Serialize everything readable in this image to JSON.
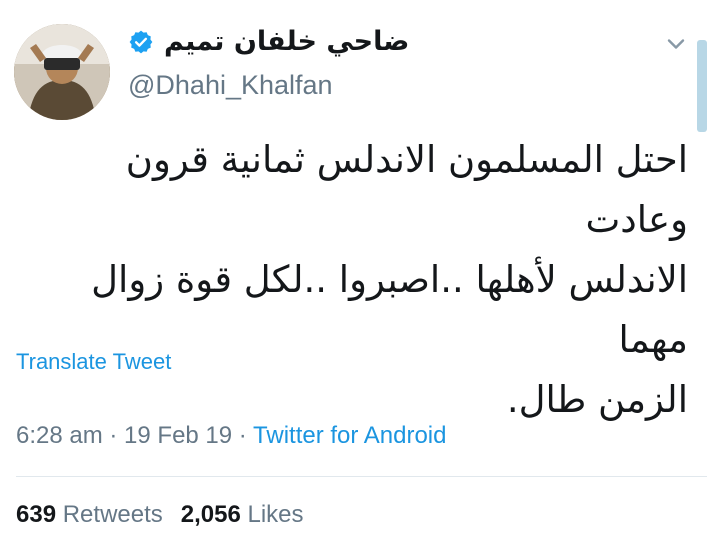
{
  "author": {
    "display_name": "ضاحي خلفان تميم",
    "handle": "@Dhahi_Khalfan",
    "verified_icon": "verified-badge-icon"
  },
  "tweet": {
    "lines": [
      "احتل المسلمون الاندلس ثمانية قرون وعادت",
      "الاندلس لأهلها ..اصبروا ..لكل قوة زوال مهما",
      "الزمن طال."
    ]
  },
  "actions": {
    "translate_label": "Translate Tweet"
  },
  "meta": {
    "time": "6:28 am",
    "sep1": " · ",
    "date": "19 Feb 19",
    "sep2": " · ",
    "source": "Twitter for Android"
  },
  "stats": {
    "retweets_count": "639",
    "retweets_label": "Retweets",
    "likes_count": "2,056",
    "likes_label": "Likes"
  },
  "colors": {
    "link": "#1b95e0",
    "secondary_text": "#657786",
    "primary_text": "#14171a"
  }
}
